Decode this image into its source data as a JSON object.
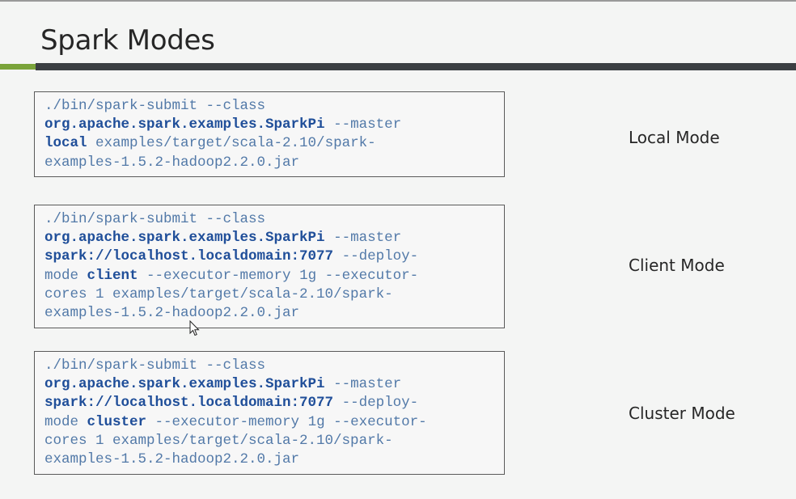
{
  "slide": {
    "title": "Spark Modes"
  },
  "blocks": [
    {
      "mode_label": "Local Mode",
      "lines": [
        [
          {
            "t": "./bin/spark-submit --class",
            "b": false
          }
        ],
        [
          {
            "t": "org.apache.spark.examples.SparkPi",
            "b": true
          },
          {
            "t": " --master",
            "b": false
          }
        ],
        [
          {
            "t": "local",
            "b": true
          },
          {
            "t": " examples/target/scala-2.10/spark-",
            "b": false
          }
        ],
        [
          {
            "t": "examples-1.5.2-hadoop2.2.0.jar",
            "b": false
          }
        ]
      ]
    },
    {
      "mode_label": "Client Mode",
      "lines": [
        [
          {
            "t": "./bin/spark-submit --class",
            "b": false
          }
        ],
        [
          {
            "t": "org.apache.spark.examples.SparkPi",
            "b": true
          },
          {
            "t": " --master",
            "b": false
          }
        ],
        [
          {
            "t": "spark://localhost.localdomain:7077",
            "b": true
          },
          {
            "t": " --deploy-",
            "b": false
          }
        ],
        [
          {
            "t": "mode ",
            "b": false
          },
          {
            "t": "client",
            "b": true
          },
          {
            "t": " --executor-memory 1g --executor-",
            "b": false
          }
        ],
        [
          {
            "t": "cores 1 examples/target/scala-2.10/spark-",
            "b": false
          }
        ],
        [
          {
            "t": "examples-1.5.2-hadoop2.2.0.jar",
            "b": false
          }
        ]
      ]
    },
    {
      "mode_label": "Cluster Mode",
      "lines": [
        [
          {
            "t": "./bin/spark-submit --class",
            "b": false
          }
        ],
        [
          {
            "t": "org.apache.spark.examples.SparkPi",
            "b": true
          },
          {
            "t": " --master",
            "b": false
          }
        ],
        [
          {
            "t": "spark://localhost.localdomain:7077",
            "b": true
          },
          {
            "t": " --deploy-",
            "b": false
          }
        ],
        [
          {
            "t": "mode ",
            "b": false
          },
          {
            "t": "cluster",
            "b": true
          },
          {
            "t": " --executor-memory 1g --executor-",
            "b": false
          }
        ],
        [
          {
            "t": "cores 1 examples/target/scala-2.10/spark-",
            "b": false
          }
        ],
        [
          {
            "t": "examples-1.5.2-hadoop2.2.0.jar",
            "b": false
          }
        ]
      ]
    }
  ],
  "colors": {
    "accent_green": "#7aa33a",
    "rule_dark": "#3b3f42",
    "code_text": "#5279a8",
    "code_bold": "#1f4e99"
  },
  "icons": {
    "cursor": "mouse-pointer-icon"
  }
}
